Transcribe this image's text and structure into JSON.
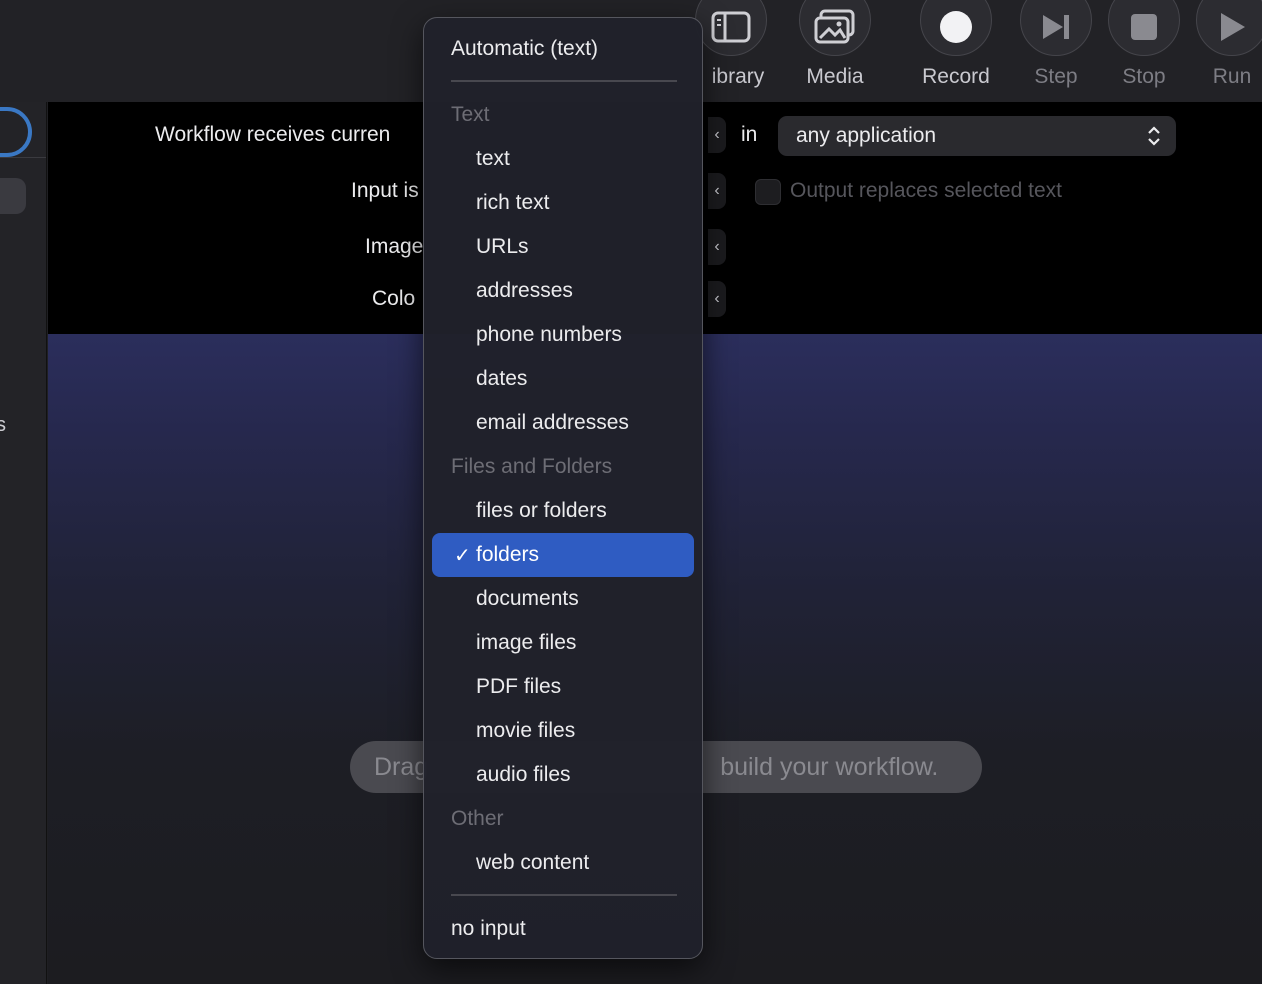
{
  "toolbar": {
    "buttons": [
      {
        "label": "Library",
        "visible_label": "ibrary",
        "icon": "library-sidebar-icon",
        "dim": false
      },
      {
        "label": "Media",
        "icon": "media-photos-icon",
        "dim": false
      },
      {
        "label": "Record",
        "icon": "record-dot-icon",
        "dim": false
      },
      {
        "label": "Step",
        "icon": "step-forward-icon",
        "dim": true
      },
      {
        "label": "Stop",
        "icon": "stop-square-icon",
        "dim": true
      },
      {
        "label": "Run",
        "icon": "play-triangle-icon",
        "dim": true
      }
    ]
  },
  "sidebar": {
    "fragment_text": "s"
  },
  "workflow_options": {
    "receives_label": "Workflow receives curren",
    "input_label": "Input is",
    "image_label": "Image",
    "color_label": "Colo",
    "in_label": "in",
    "application_value": "any application",
    "output_replaces_label": "Output replaces selected text"
  },
  "canvas": {
    "hint_left": "Drag",
    "hint_right": "build your workflow."
  },
  "menu": {
    "top_item": "Automatic (text)",
    "text_header": "Text",
    "text_items": [
      "text",
      "rich text",
      "URLs",
      "addresses",
      "phone numbers",
      "dates",
      "email addresses"
    ],
    "files_header": "Files and Folders",
    "files_items": [
      "files or folders",
      "folders",
      "documents",
      "image files",
      "PDF files",
      "movie files",
      "audio files"
    ],
    "selected": "folders",
    "check_mark": "✓",
    "other_header": "Other",
    "other_items": [
      "web content"
    ],
    "bottom_item": "no input"
  },
  "colors": {
    "selection": "#2f5cc2",
    "sidebar_focus": "#3a78c4",
    "canvas_top": "#2b2e5c"
  }
}
